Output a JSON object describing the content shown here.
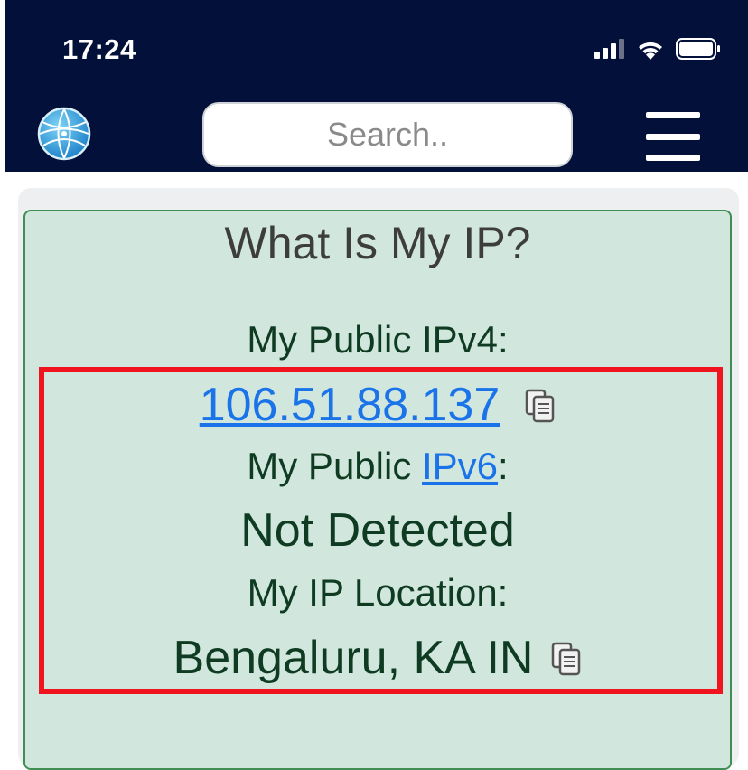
{
  "status_bar": {
    "time": "17:24"
  },
  "header": {
    "search_placeholder": "Search.."
  },
  "card": {
    "title": "What Is My IP?",
    "ipv4_label": "My Public IPv4:",
    "ipv4_value": "106.51.88.137",
    "ipv6_label_prefix": "My Public ",
    "ipv6_link": "IPv6",
    "ipv6_label_suffix": ":",
    "ipv6_value": "Not Detected",
    "location_label": "My IP Location:",
    "location_value": "Bengaluru, KA IN"
  },
  "colors": {
    "header_bg": "#03113a",
    "card_bg": "#d1e7dd",
    "link": "#1a73e8",
    "highlight": "#f0141e"
  }
}
